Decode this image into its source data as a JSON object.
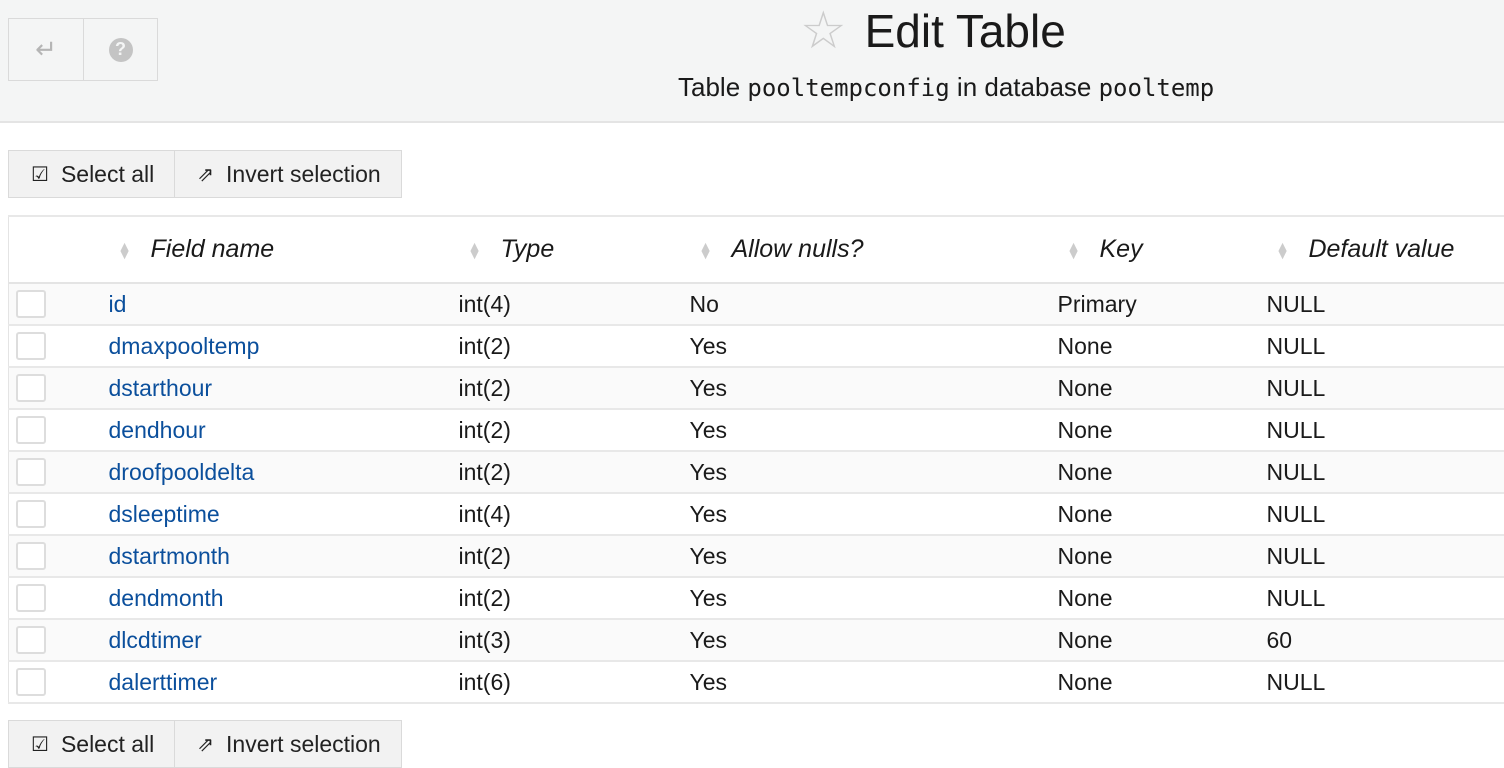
{
  "header": {
    "title": "Edit Table",
    "subtitle_prefix": "Table",
    "table_name": "pooltempconfig",
    "subtitle_mid": "in database",
    "database_name": "pooltemp"
  },
  "toolbar": {
    "select_all": "Select all",
    "invert_selection": "Invert selection"
  },
  "columns": [
    "Field name",
    "Type",
    "Allow nulls?",
    "Key",
    "Default value"
  ],
  "rows": [
    {
      "field": "id",
      "type": "int(4)",
      "nulls": "No",
      "key": "Primary",
      "default": "NULL"
    },
    {
      "field": "dmaxpooltemp",
      "type": "int(2)",
      "nulls": "Yes",
      "key": "None",
      "default": "NULL"
    },
    {
      "field": "dstarthour",
      "type": "int(2)",
      "nulls": "Yes",
      "key": "None",
      "default": "NULL"
    },
    {
      "field": "dendhour",
      "type": "int(2)",
      "nulls": "Yes",
      "key": "None",
      "default": "NULL"
    },
    {
      "field": "droofpooldelta",
      "type": "int(2)",
      "nulls": "Yes",
      "key": "None",
      "default": "NULL"
    },
    {
      "field": "dsleeptime",
      "type": "int(4)",
      "nulls": "Yes",
      "key": "None",
      "default": "NULL"
    },
    {
      "field": "dstartmonth",
      "type": "int(2)",
      "nulls": "Yes",
      "key": "None",
      "default": "NULL"
    },
    {
      "field": "dendmonth",
      "type": "int(2)",
      "nulls": "Yes",
      "key": "None",
      "default": "NULL"
    },
    {
      "field": "dlcdtimer",
      "type": "int(3)",
      "nulls": "Yes",
      "key": "None",
      "default": "60"
    },
    {
      "field": "dalerttimer",
      "type": "int(6)",
      "nulls": "Yes",
      "key": "None",
      "default": "NULL"
    }
  ]
}
